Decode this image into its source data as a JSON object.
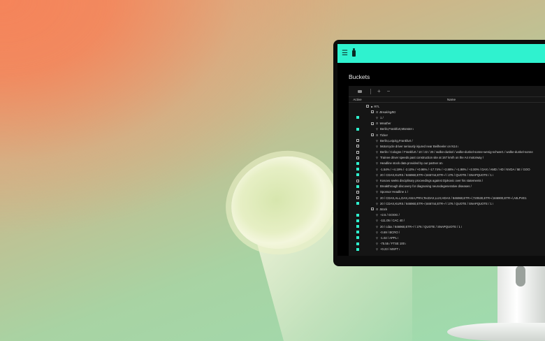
{
  "page": {
    "title": "Buckets"
  },
  "toolbar": {
    "add_label": "+",
    "remove_label": "−"
  },
  "columns": {
    "active": "Active",
    "name": "Name"
  },
  "rows": [
    {
      "level": 0,
      "type": "group",
      "icon": "folder-icon",
      "label": "RTL",
      "checkbox": false
    },
    {
      "level": 1,
      "type": "group",
      "icon": "bucket-icon",
      "label": "BreakingBG",
      "checkbox": false
    },
    {
      "level": 2,
      "type": "leaf",
      "label": "1 /",
      "checkbox": true,
      "checked": true
    },
    {
      "level": 1,
      "type": "group",
      "icon": "bucket-icon",
      "label": "Weather",
      "checkbox": false
    },
    {
      "level": 2,
      "type": "leaf",
      "label": "Berlin,Frankfurt,Münster /",
      "checkbox": true,
      "checked": true
    },
    {
      "level": 1,
      "type": "group",
      "icon": "bucket-icon",
      "label": "Ticker",
      "checkbox": false
    },
    {
      "level": 2,
      "type": "leaf",
      "label": "Berlin,Leipzig,Frankfurt /",
      "checkbox": true,
      "checked": false
    },
    {
      "level": 2,
      "type": "leaf",
      "label": "Motorcycle driver seriously injured near Beilheeler on N14 /",
      "checkbox": true,
      "checked": false
    },
    {
      "level": 2,
      "type": "leaf",
      "label": "Berlin / Cologne / Frankfurt / 10 / 22 / 20 / wolke-dunkel / wolke-dunkel-sonne-wenig-schwer1 / wolke-dunkel-sonne",
      "checkbox": true,
      "checked": false
    },
    {
      "level": 2,
      "type": "leaf",
      "label": "Trainee driver speeds past construction site at 167 km/h on the A4 motorway /",
      "checkbox": true,
      "checked": false
    },
    {
      "level": 2,
      "type": "leaf",
      "label": "Headline stock data provided by our partner at /",
      "checkbox": true,
      "checked": true
    },
    {
      "level": 2,
      "type": "leaf",
      "label": "-1.54% / +4.19% / -2.10% / +0.96% / -17.74% / +2.88% / +1.98% / +2.00% / DAX / AMD / HD / NVDA / 5E / GOO",
      "checkbox": true,
      "checked": true
    },
    {
      "level": 2,
      "type": "leaf",
      "label": "20 / CDAX,KURS / 846960,ETR~/,846744,ETR~/ / 276 / QUOTE / SNAPQUOTE / 1 /",
      "checkbox": true,
      "checked": true
    },
    {
      "level": 2,
      "type": "leaf",
      "label": "Kosovo seeks disciplinary proceedings against Djokovic over his statements /",
      "checkbox": true,
      "checked": false
    },
    {
      "level": 2,
      "type": "leaf",
      "label": "Breakthrough discovery for diagnosing neurodegenerative diseases /",
      "checkbox": true,
      "checked": true
    },
    {
      "level": 2,
      "type": "leaf",
      "label": "Sponsor Headline 1 /",
      "checkbox": true,
      "checked": false
    },
    {
      "level": 2,
      "type": "leaf",
      "label": "20 / CDAX,ALL,DAX,ASIA,PRIV,TecDAX,LUX,HDAX / 846960,ETR~/,720530,ETR~/,846900,ETR~/,A0LPVE1",
      "checkbox": true,
      "checked": false
    },
    {
      "level": 2,
      "type": "leaf",
      "label": "20 / CDAX,KURS / 846960,ETR~/,846744,ETR~/ / 276 / QUOTE / SNAPQUOTE / 1 /",
      "checkbox": true,
      "checked": true
    },
    {
      "level": 1,
      "type": "group",
      "icon": "bucket-icon",
      "label": "Stock",
      "checkbox": false
    },
    {
      "level": 2,
      "type": "leaf",
      "label": "+2.5 / GOOG /",
      "checkbox": true,
      "checked": true
    },
    {
      "level": 2,
      "type": "leaf",
      "label": "-111.05 / CAC 40 /",
      "checkbox": true,
      "checked": true
    },
    {
      "level": 2,
      "type": "leaf",
      "label": "20 / cdax / 846960,ETR~/ / 276 / QUOTE / SNAPQUOTE / 1 /",
      "checkbox": true,
      "checked": true
    },
    {
      "level": 2,
      "type": "leaf",
      "label": "-0.69 / BCRO /",
      "checkbox": true,
      "checked": true
    },
    {
      "level": 2,
      "type": "leaf",
      "label": "-1.02 / APPL /",
      "checkbox": true,
      "checked": true
    },
    {
      "level": 2,
      "type": "leaf",
      "label": "-75.55 / FTSE 100 /",
      "checkbox": true,
      "checked": true
    },
    {
      "level": 2,
      "type": "leaf",
      "label": "+0.23 / MSFT /",
      "checkbox": true,
      "checked": true
    }
  ],
  "colors": {
    "accent": "#2ff2cf",
    "screen_bg": "#000000",
    "panel_bg": "#151515"
  }
}
